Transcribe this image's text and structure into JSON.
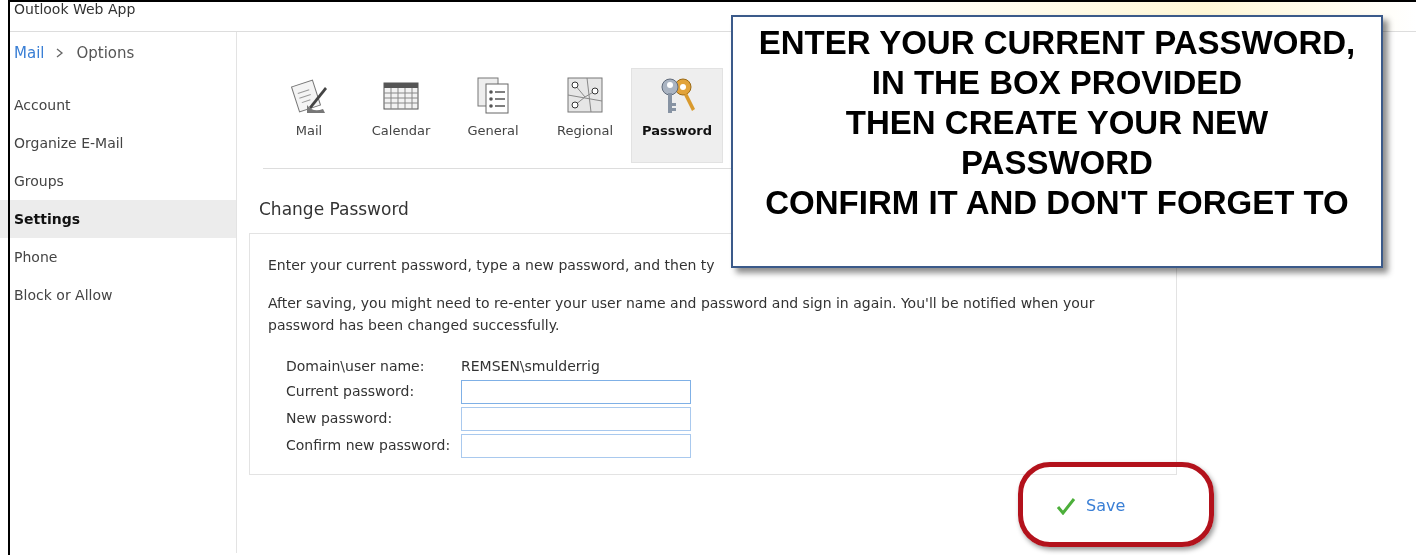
{
  "window": {
    "title": "Outlook Web App"
  },
  "breadcrumb": [
    {
      "label": "Mail",
      "kind": "link"
    },
    {
      "label": "Options",
      "kind": "current"
    }
  ],
  "sidebar": {
    "items": [
      {
        "label": "Account",
        "selected": false
      },
      {
        "label": "Organize E-Mail",
        "selected": false
      },
      {
        "label": "Groups",
        "selected": false
      },
      {
        "label": "Settings",
        "selected": true
      },
      {
        "label": "Phone",
        "selected": false
      },
      {
        "label": "Block or Allow",
        "selected": false
      }
    ]
  },
  "toolbar": {
    "items": [
      {
        "label": "Mail",
        "kind": "mail",
        "selected": false
      },
      {
        "label": "Calendar",
        "kind": "calendar",
        "selected": false
      },
      {
        "label": "General",
        "kind": "general",
        "selected": false
      },
      {
        "label": "Regional",
        "kind": "regional",
        "selected": false
      },
      {
        "label": "Password",
        "kind": "password",
        "selected": true
      }
    ]
  },
  "section": {
    "title": "Change Password",
    "paragraphs": [
      "Enter your current password, type a new password, and then ty",
      "After saving, you might need to re-enter your user name and password and sign in again. You'll be notified when your password has been changed successfully."
    ],
    "fields": [
      {
        "label": "Domain\\user name:",
        "kind": "static",
        "value": "REMSEN\\smulderrig"
      },
      {
        "label": "Current password:",
        "kind": "input",
        "focused": true
      },
      {
        "label": "New password:",
        "kind": "input",
        "focused": false
      },
      {
        "label": "Confirm new password:",
        "kind": "input",
        "focused": false
      }
    ]
  },
  "save_button": {
    "label": "Save"
  },
  "callout": {
    "lines": [
      "ENTER YOUR CURRENT PASSWORD,",
      "IN THE BOX PROVIDED",
      "THEN CREATE YOUR NEW",
      "PASSWORD",
      "CONFIRM IT AND DON'T FORGET TO"
    ]
  }
}
